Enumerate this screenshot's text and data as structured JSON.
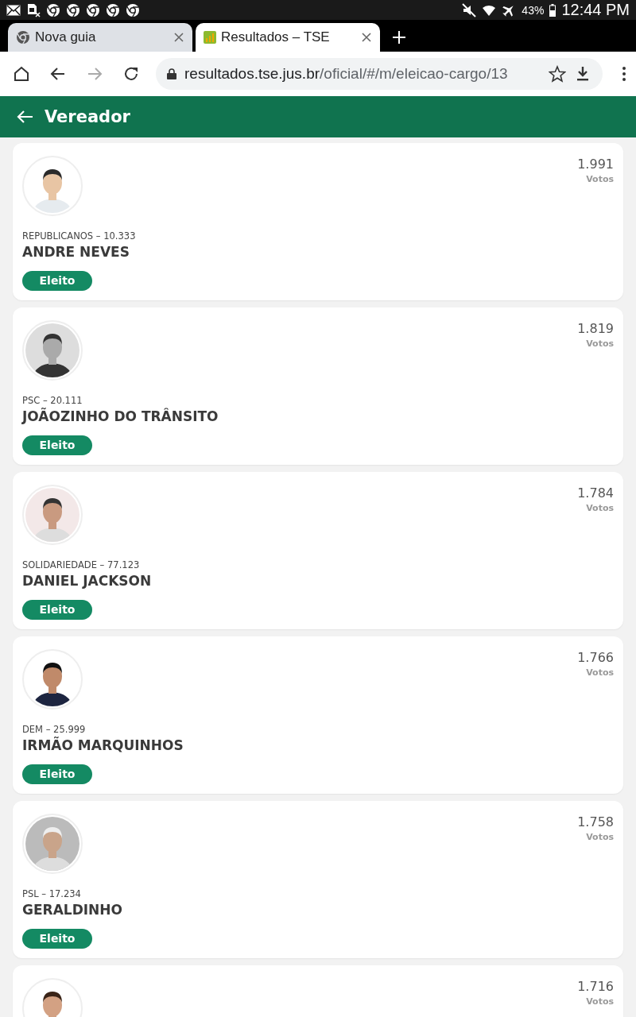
{
  "status_bar": {
    "battery": "43%",
    "time": "12:44 PM"
  },
  "tabs": [
    {
      "title": "Nova guia",
      "selected": false
    },
    {
      "title": "Resultados – TSE",
      "selected": true
    }
  ],
  "address_bar": {
    "host": "resultados.tse.jus.br",
    "path": "/oficial/#/m/eleicao-cargo/13"
  },
  "header": {
    "title": "Vereador"
  },
  "candidates": [
    {
      "party": "REPUBLICANOS – 10.333",
      "name": "ANDRE NEVES",
      "status": "Eleito",
      "votes": "1.991",
      "votes_label": "Votos"
    },
    {
      "party": "PSC – 20.111",
      "name": "JOÃOZINHO DO TRÂNSITO",
      "status": "Eleito",
      "votes": "1.819",
      "votes_label": "Votos"
    },
    {
      "party": "SOLIDARIEDADE – 77.123",
      "name": "DANIEL JACKSON",
      "status": "Eleito",
      "votes": "1.784",
      "votes_label": "Votos"
    },
    {
      "party": "DEM – 25.999",
      "name": "IRMÃO MARQUINHOS",
      "status": "Eleito",
      "votes": "1.766",
      "votes_label": "Votos"
    },
    {
      "party": "PSL – 17.234",
      "name": "GERALDINHO",
      "status": "Eleito",
      "votes": "1.758",
      "votes_label": "Votos"
    },
    {
      "votes": "1.716",
      "votes_label": "Votos"
    }
  ]
}
